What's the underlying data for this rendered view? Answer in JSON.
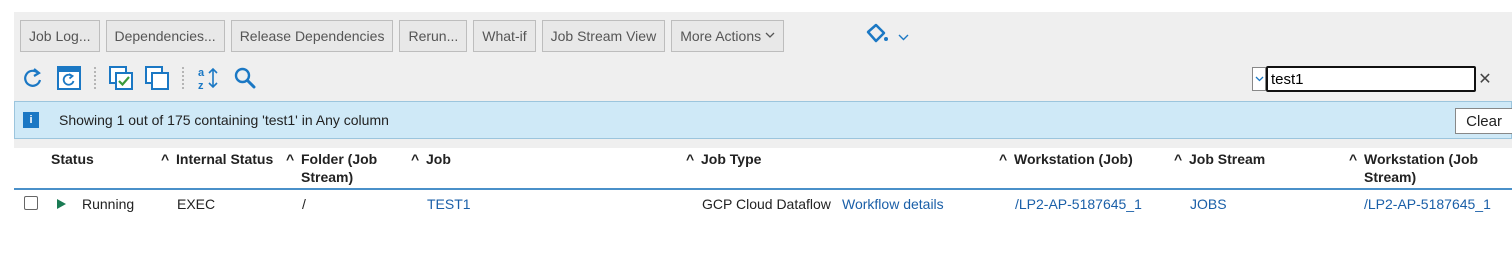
{
  "toolbar": {
    "job_log": "Job Log...",
    "dependencies": "Dependencies...",
    "release_dependencies": "Release Dependencies",
    "rerun": "Rerun...",
    "what_if": "What-if",
    "job_stream_view": "Job Stream View",
    "more_actions": "More Actions"
  },
  "icons": {
    "refresh": "refresh-icon",
    "auto_refresh": "auto-refresh-icon",
    "select_all": "select-all-icon",
    "deselect": "deselect-all-icon",
    "sort": "sort-icon",
    "search": "search-icon",
    "brush": "paint-bucket-icon",
    "accent": "#1b78c4"
  },
  "filter": {
    "value": "test1"
  },
  "info": {
    "text": "Showing 1 out of 175 containing 'test1' in Any column",
    "clear_label": "Clear"
  },
  "columns": {
    "status": "Status",
    "internal_status": "Internal Status",
    "folder_line1": "Folder (Job",
    "folder_line2": "Stream)",
    "job": "Job",
    "job_type": "Job Type",
    "workstation_job": "Workstation (Job)",
    "job_stream": "Job Stream",
    "ws_js_line1": "Workstation (Job",
    "ws_js_line2": "Stream)"
  },
  "rows": [
    {
      "status": "Running",
      "internal_status": "EXEC",
      "folder": "/",
      "job": "TEST1",
      "job_type": "GCP Cloud Dataflow",
      "job_type_link": "Workflow details",
      "workstation_job": "/LP2-AP-5187645_1",
      "job_stream": "JOBS",
      "workstation_job_stream": "/LP2-AP-5187645_1"
    }
  ]
}
